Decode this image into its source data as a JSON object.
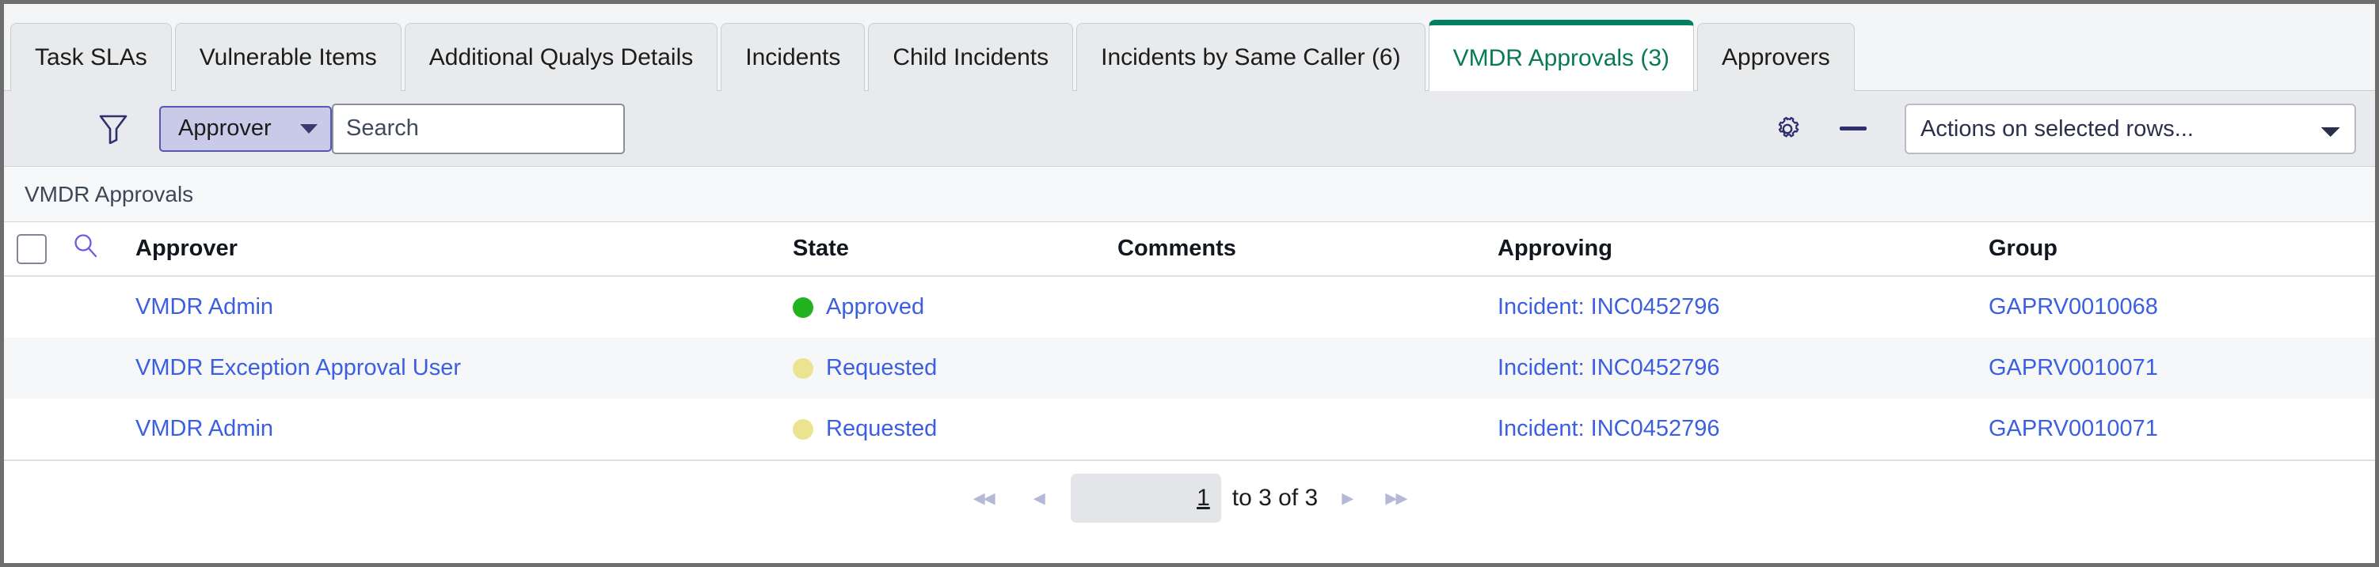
{
  "tabs": [
    {
      "label": "Task SLAs",
      "active": false
    },
    {
      "label": "Vulnerable Items",
      "active": false
    },
    {
      "label": "Additional Qualys Details",
      "active": false
    },
    {
      "label": "Incidents",
      "active": false
    },
    {
      "label": "Child Incidents",
      "active": false
    },
    {
      "label": "Incidents by Same Caller (6)",
      "active": false
    },
    {
      "label": "VMDR Approvals (3)",
      "active": true
    },
    {
      "label": "Approvers",
      "active": false
    }
  ],
  "toolbar": {
    "menu_icon": "hamburger-menu-icon",
    "filter_icon": "funnel-filter-icon",
    "field_selector_label": "Approver",
    "search_placeholder": "Search",
    "search_value": "",
    "settings_icon": "gear-icon",
    "collapse_icon": "minus-icon",
    "actions_selected_value": "Actions on selected rows...",
    "actions_options": [
      "Actions on selected rows..."
    ]
  },
  "breadcrumb": {
    "label": "VMDR Approvals"
  },
  "table": {
    "header_search_icon": "magnifier-icon",
    "columns": [
      {
        "key": "approver",
        "label": "Approver"
      },
      {
        "key": "state",
        "label": "State"
      },
      {
        "key": "comments",
        "label": "Comments"
      },
      {
        "key": "approving",
        "label": "Approving"
      },
      {
        "key": "group",
        "label": "Group"
      }
    ],
    "rows": [
      {
        "approver": "VMDR Admin",
        "state": "Approved",
        "state_color": "#22b31e",
        "comments": "",
        "approving": "Incident: INC0452796",
        "group": "GAPRV0010068"
      },
      {
        "approver": "VMDR Exception Approval User",
        "state": "Requested",
        "state_color": "#ece391",
        "comments": "",
        "approving": "Incident: INC0452796",
        "group": "GAPRV0010071"
      },
      {
        "approver": "VMDR Admin",
        "state": "Requested",
        "state_color": "#ece391",
        "comments": "",
        "approving": "Incident: INC0452796",
        "group": "GAPRV0010071"
      }
    ]
  },
  "pagination": {
    "first_label": "◂◂",
    "prev_label": "◂",
    "page_value": "1",
    "range_label": "to 3 of 3",
    "next_label": "▸",
    "last_label": "▸▸"
  },
  "colors": {
    "accent_green": "#008060",
    "link_blue": "#3b5fe0",
    "approved_green": "#22b31e",
    "requested_yellow": "#ece391",
    "toolbar_bg": "#e9eaee",
    "pill_bg": "#c9c9e8",
    "pill_border": "#5656b4"
  }
}
